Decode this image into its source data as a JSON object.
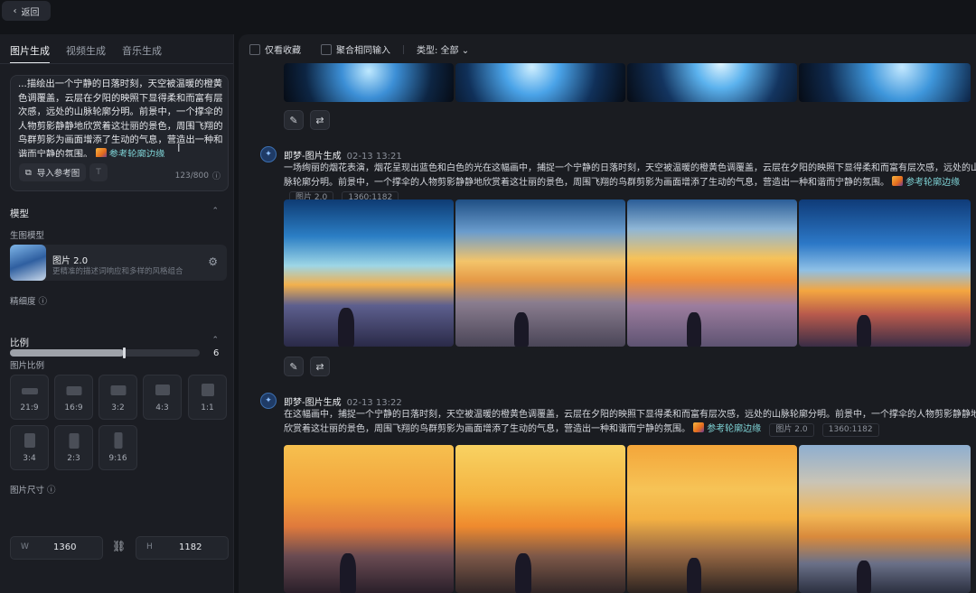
{
  "topbar": {
    "back_label": "返回"
  },
  "left": {
    "tabs": [
      {
        "label": "图片生成",
        "active": true
      },
      {
        "label": "视频生成",
        "active": false
      },
      {
        "label": "音乐生成",
        "active": false
      }
    ],
    "prompt": {
      "text": "...描绘出一个宁静的日落时刻，天空被温暖的橙黄色调覆盖，云层在夕阳的映照下显得柔和而富有层次感，远处的山脉轮廓分明。前景中，一个撑伞的人物剪影静静地欣赏着这壮丽的景色，周围飞翔的鸟群剪影为画面增添了生动的气息，营造出一种和谐而宁静的氛围。",
      "ref_chip": "参考轮廓边缘",
      "import_label": "导入参考图",
      "t_button": "T",
      "counter": "123/800"
    },
    "model_section": {
      "title": "模型",
      "sub_label": "生图模型",
      "model_name": "图片 2.0",
      "model_desc": "更精准的描述词响应和多样的风格组合"
    },
    "precision": {
      "label": "精细度",
      "value": "6",
      "fraction": 0.6
    },
    "ratio_section": {
      "title": "比例",
      "sub_label": "图片比例",
      "ratios": [
        "21:9",
        "16:9",
        "3:2",
        "4:3",
        "1:1",
        "3:4",
        "2:3",
        "9:16"
      ]
    },
    "size": {
      "label": "图片尺寸",
      "w_key": "W",
      "w_value": "1360",
      "h_key": "H",
      "h_value": "1182"
    }
  },
  "right": {
    "filters": {
      "fav_label": "仅看收藏",
      "merge_label": "聚合相同输入",
      "type_label": "类型: 全部"
    },
    "generations": [
      {
        "author": "即梦-图片生成",
        "date": "02-13",
        "time": "13:21",
        "prompt": "一场绚丽的烟花表演，烟花呈现出蓝色和白色的光在这幅画中，捕捉一个宁静的日落时刻，天空被温暖的橙黄色调覆盖，云层在夕阳的映照下显得柔和而富有层次感，远处的山脉轮廓分明。前景中，一个撑伞的人物剪影静静地欣赏着这壮丽的景色，周围飞翔的鸟群剪影为画面增添了生动的气息，营造出一种和谐而宁静的氛围。",
        "ref": "参考轮廓边缘",
        "model_tag": "图片 2.0",
        "size_tag": "1360:1182"
      },
      {
        "author": "即梦-图片生成",
        "date": "02-13",
        "time": "13:22",
        "prompt": "在这幅画中，捕捉一个宁静的日落时刻，天空被温暖的橙黄色调覆盖，云层在夕阳的映照下显得柔和而富有层次感，远处的山脉轮廓分明。前景中，一个撑伞的人物剪影静静地欣赏着这壮丽的景色，周围飞翔的鸟群剪影为画面增添了生动的气息，营造出一种和谐而宁静的氛围。",
        "ref": "参考轮廓边缘",
        "model_tag": "图片 2.0",
        "size_tag": "1360:1182"
      }
    ]
  }
}
